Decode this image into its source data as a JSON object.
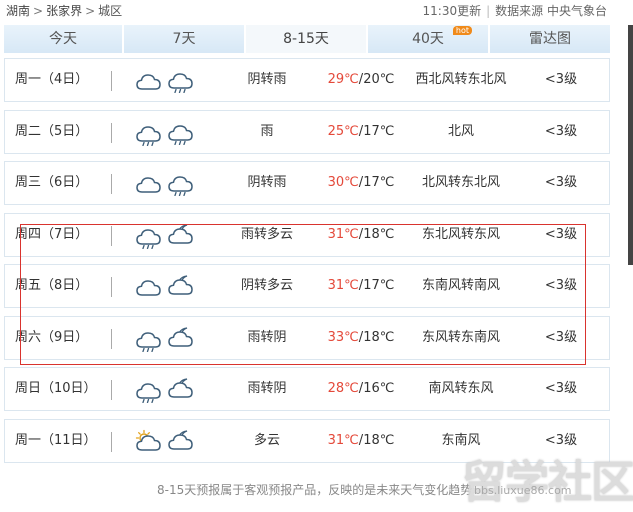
{
  "breadcrumb": {
    "province": "湖南",
    "city": "张家界",
    "district": "城区"
  },
  "meta": {
    "update_time": "11:30更新",
    "source": "数据来源 中央气象台"
  },
  "tabs": [
    {
      "label": "今天",
      "active": false
    },
    {
      "label": "7天",
      "active": false
    },
    {
      "label": "8-15天",
      "active": true
    },
    {
      "label": "40天",
      "active": false,
      "badge": "hot"
    },
    {
      "label": "雷达图",
      "active": false
    }
  ],
  "forecast": [
    {
      "date": "周一（4日）",
      "icon_day": "cloudy-icon",
      "icon_night": "rain-icon",
      "weather": "阴转雨",
      "high": "29℃",
      "low": "20℃",
      "wind": "西北风转东北风",
      "level": "<3级"
    },
    {
      "date": "周二（5日）",
      "icon_day": "rain-icon",
      "icon_night": "rain-icon",
      "weather": "雨",
      "high": "25℃",
      "low": "17℃",
      "wind": "北风",
      "level": "<3级"
    },
    {
      "date": "周三（6日）",
      "icon_day": "cloudy-icon",
      "icon_night": "rain-icon",
      "weather": "阴转雨",
      "high": "30℃",
      "low": "17℃",
      "wind": "北风转东北风",
      "level": "<3级"
    },
    {
      "date": "周四（7日）",
      "icon_day": "rain-icon",
      "icon_night": "partly-cloudy-night-icon",
      "weather": "雨转多云",
      "high": "31℃",
      "low": "18℃",
      "wind": "东北风转东风",
      "level": "<3级"
    },
    {
      "date": "周五（8日）",
      "icon_day": "cloudy-icon",
      "icon_night": "partly-cloudy-night-icon",
      "weather": "阴转多云",
      "high": "31℃",
      "low": "17℃",
      "wind": "东南风转南风",
      "level": "<3级"
    },
    {
      "date": "周六（9日）",
      "icon_day": "rain-icon",
      "icon_night": "cloudy-night-icon",
      "weather": "雨转阴",
      "high": "33℃",
      "low": "18℃",
      "wind": "东风转东南风",
      "level": "<3级"
    },
    {
      "date": "周日（10日）",
      "icon_day": "rain-icon",
      "icon_night": "cloudy-night-icon",
      "weather": "雨转阴",
      "high": "28℃",
      "low": "16℃",
      "wind": "南风转东风",
      "level": "<3级"
    },
    {
      "date": "周一（11日）",
      "icon_day": "partly-cloudy-sun-icon",
      "icon_night": "partly-cloudy-night-icon",
      "weather": "多云",
      "high": "31℃",
      "low": "18℃",
      "wind": "东南风",
      "level": "<3级"
    }
  ],
  "footnote": "8-15天预报属于客观预报产品，反映的是未来天气变化趋势",
  "watermark": {
    "main": "留学社区",
    "sub": "bbs.liuxue86.com"
  },
  "colors": {
    "accent_temp": "#e4493a",
    "highlight_border": "#d9332e",
    "tab_bg": "#d7e8f6",
    "hot_badge": "#f08a1a"
  }
}
